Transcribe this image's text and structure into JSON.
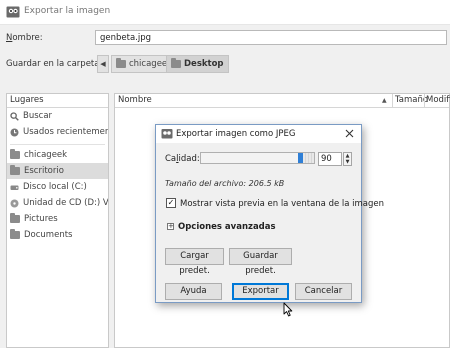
{
  "window": {
    "title": "Exportar la imagen"
  },
  "form": {
    "name_label": "Nombre:",
    "name_value": "genbeta.jpg",
    "folder_label": "Guardar en la carpeta:",
    "breadcrumbs": [
      "chicageek",
      "Desktop"
    ]
  },
  "places": {
    "header": "Lugares",
    "items": [
      {
        "label": "Buscar",
        "icon": "search-icon"
      },
      {
        "label": "Usados recientemente",
        "icon": "recent-icon"
      },
      {
        "label": "chicageek",
        "icon": "folder-icon"
      },
      {
        "label": "Escritorio",
        "icon": "folder-icon"
      },
      {
        "label": "Disco local (C:)",
        "icon": "drive-icon"
      },
      {
        "label": "Unidad de CD (D:) Vir...",
        "icon": "cd-drive-icon"
      },
      {
        "label": "Pictures",
        "icon": "folder-icon"
      },
      {
        "label": "Documents",
        "icon": "folder-icon"
      }
    ]
  },
  "files": {
    "columns": [
      "Nombre",
      "Tamaño",
      "Modifi"
    ]
  },
  "dialog": {
    "title": "Exportar imagen como JPEG",
    "quality_label": "Calidad:",
    "quality_value": "90",
    "quality_fraction": 0.9,
    "file_size": "Tamaño del archivo: 206.5 kB",
    "preview_label": "Mostrar vista previa en la ventana de la imagen",
    "preview_checked": true,
    "advanced_label": "Opciones avanzadas",
    "load_defaults": "Cargar predet.",
    "save_defaults": "Guardar predet.",
    "help": "Ayuda",
    "export": "Exportar",
    "cancel": "Cancelar"
  },
  "colors": {
    "slider_fill": "#2f7fd6",
    "dialog_border": "#7a9bc4",
    "primary_button_border": "#0078d7"
  }
}
